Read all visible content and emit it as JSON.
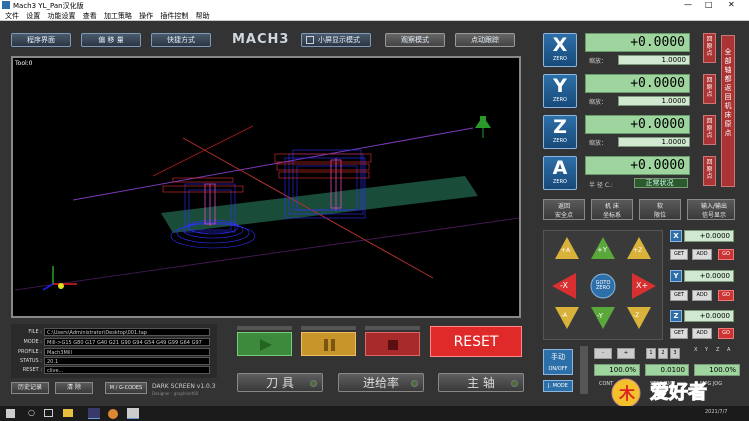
{
  "window": {
    "title": "Mach3 YL_Pan汉化版",
    "minimize": "—",
    "maximize": "□",
    "close": "✕"
  },
  "menu": [
    "文件",
    "设置",
    "功能设置",
    "查看",
    "加工策略",
    "操作",
    "插件控制",
    "帮助"
  ],
  "top_buttons": {
    "program": "程序界面",
    "offset": "偏 移 量",
    "shortcuts": "快捷方式",
    "logo": "MACH3",
    "small_screen": "小屏显示模式",
    "observe": "观察模式",
    "jog_trace": "点动跟踪"
  },
  "viewport": {
    "tool_label": "Tool:0"
  },
  "axes": [
    {
      "letter": "X",
      "zero": "ZERO",
      "value": "+0.0000",
      "scale_label": "缩放：",
      "scale": "1.0000",
      "ref": "回原点"
    },
    {
      "letter": "Y",
      "zero": "ZERO",
      "value": "+0.0000",
      "scale_label": "缩放：",
      "scale": "1.0000",
      "ref": "回原点"
    },
    {
      "letter": "Z",
      "zero": "ZERO",
      "value": "+0.0000",
      "scale_label": "缩放：",
      "scale": "1.0000",
      "ref": "回原点"
    },
    {
      "letter": "A",
      "zero": "ZERO",
      "value": "+0.0000",
      "scale_label": "半 径 C.:",
      "scale": "正常状况",
      "ref": "回原点"
    }
  ],
  "all_zero": "全部轴都返回机床原点",
  "coord_buttons": {
    "return_safe": "返回\n安全点",
    "machine_coords": "机 床\n坐标系",
    "soft_limits": "软\n限位",
    "io_signals": "输入/输出\n信号显示"
  },
  "jog": {
    "plus_a": "+A",
    "plus_y": "+Y",
    "plus_z": "+Z",
    "minus_x": "-X",
    "goto_zero": "GOTO ZERO",
    "plus_x": "X+",
    "minus_a": "-A",
    "minus_y": "-Y",
    "minus_z": "-Z",
    "center_plus": "+",
    "center_minus": "-"
  },
  "small_dros": [
    {
      "axis": "X",
      "value": "+0.0000",
      "get": "GET",
      "add": "ADD",
      "go": "GO"
    },
    {
      "axis": "Y",
      "value": "+0.0000",
      "get": "GET",
      "add": "ADD",
      "go": "GO"
    },
    {
      "axis": "Z",
      "value": "+0.0000",
      "get": "GET",
      "add": "ADD",
      "go": "GO"
    }
  ],
  "info": [
    {
      "label": "FILE :",
      "value": "C:\\Users\\Administrator\\Desktop\\001.tap"
    },
    {
      "label": "MODE :",
      "value": "Mill->G15  G80 G17 G40 G21 G90 G94 G54 G49 G99 G64 G97"
    },
    {
      "label": "PROFILE :",
      "value": "Mach3Mill"
    },
    {
      "label": "STATUS :",
      "value": "20.1"
    },
    {
      "label": "RESET :",
      "value": "clive..."
    }
  ],
  "bottom_left": {
    "history": "历史记录",
    "clear": "清 除",
    "gcodes": "M / G-CODES",
    "skin": "DARK SCREEN v1.0.3",
    "designer": "Designer : graphinet60"
  },
  "run": {
    "reset": "RESET"
  },
  "status_buttons": {
    "tool": "刀 具",
    "feed": "进给率",
    "spindle": "主 轴"
  },
  "manual": {
    "label": "手动",
    "onoff": "ON/OFF",
    "jmode": "J. MODE",
    "minus": "-",
    "plus": "+",
    "n1": "1",
    "n2": "2",
    "n3": "3",
    "x": "X",
    "y": "Y",
    "z": "Z",
    "a": "A",
    "pct1": "100.0%",
    "step": "0.0100",
    "pct2": "100.0%",
    "step_jog": "STEP JOG",
    "mpg_jog": "MPG JOG",
    "cont": "CONT"
  },
  "taskbar": {
    "time": "",
    "date": "2021/7/7"
  },
  "watermark": "爱好者"
}
